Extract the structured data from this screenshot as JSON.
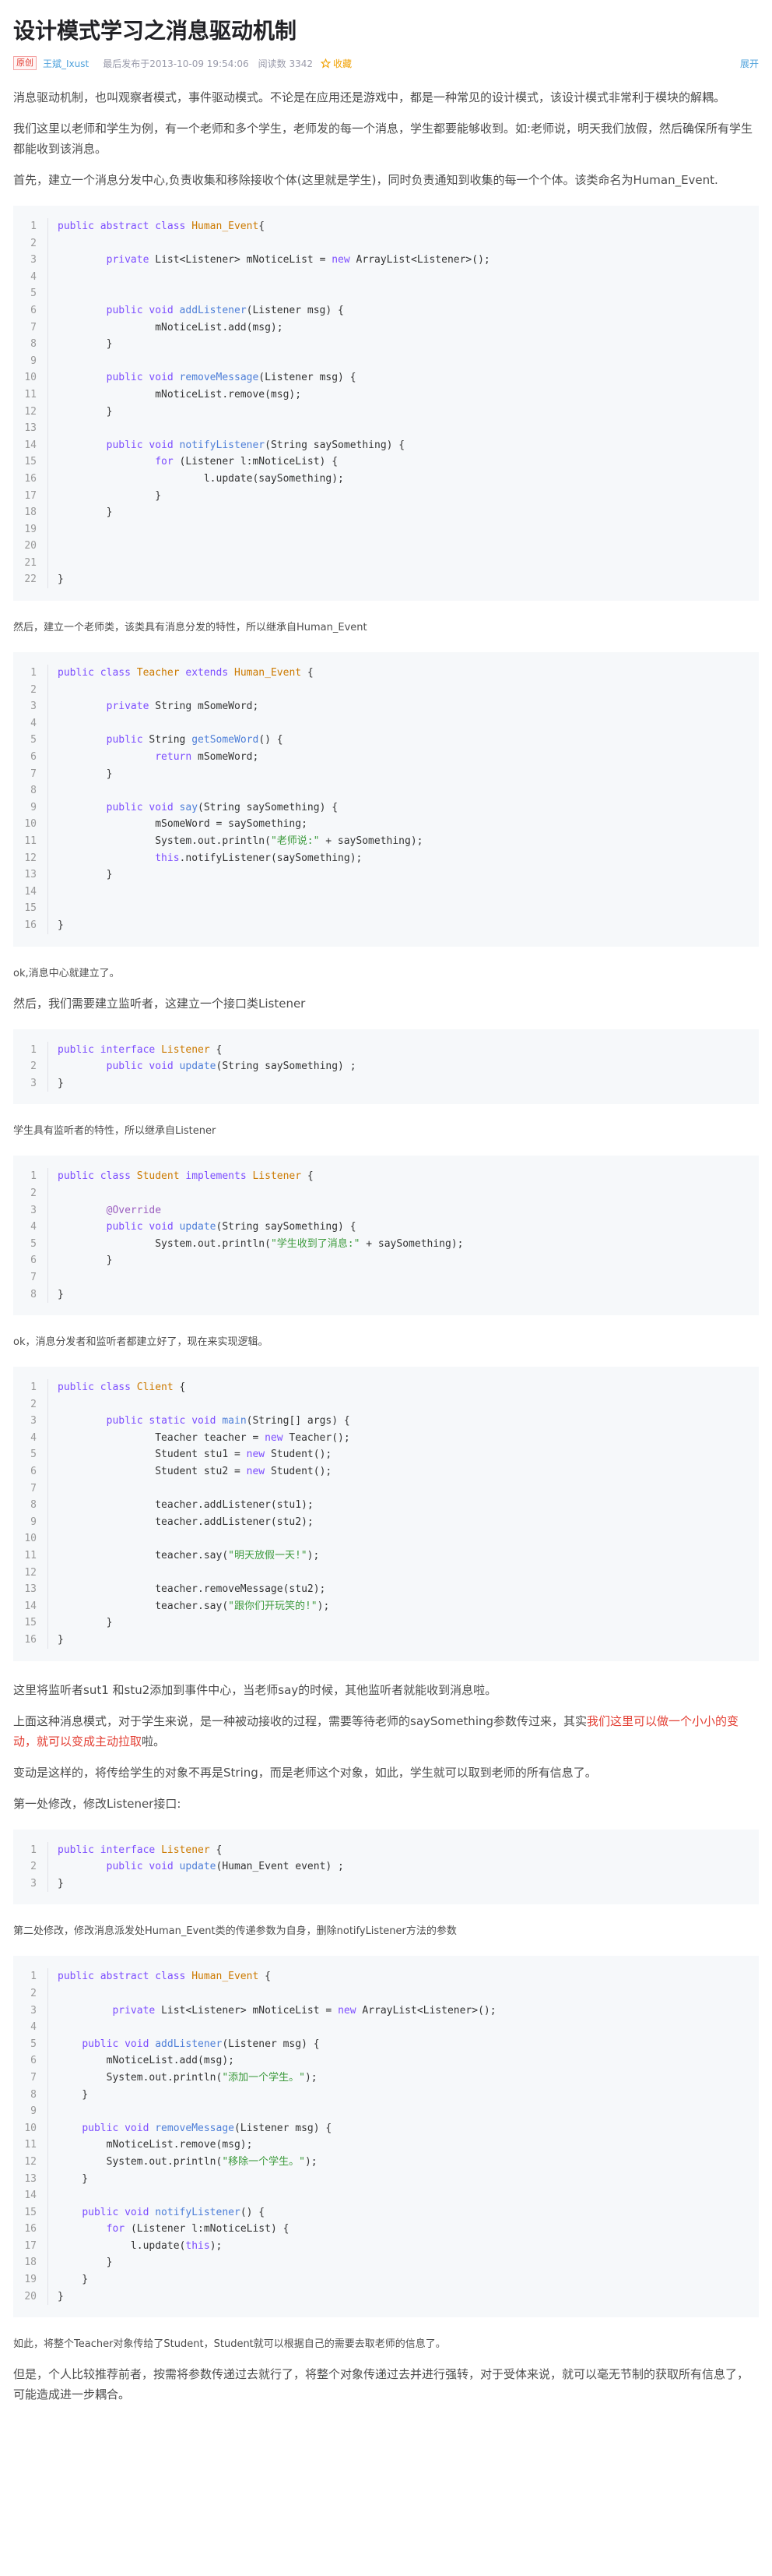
{
  "article": {
    "title": "设计模式学习之消息驱动机制",
    "meta": {
      "badge": "原创",
      "author": "王斌_Ixust",
      "date": "最后发布于2013-10-09 19:54:06",
      "views": "阅读数 3342",
      "favorite": "收藏",
      "expand": "展开"
    }
  },
  "paragraphs": {
    "p1": "消息驱动机制，也叫观察者模式，事件驱动模式。不论是在应用还是游戏中，都是一种常见的设计模式，该设计模式非常利于模块的解耦。",
    "p2": "我们这里以老师和学生为例，有一个老师和多个学生，老师发的每一个消息，学生都要能够收到。如:老师说，明天我们放假，然后确保所有学生都能收到该消息。",
    "p3": "首先，建立一个消息分发中心,负责收集和移除接收个体(这里就是学生)，同时负责通知到收集的每一个个体。该类命名为Human_Event.",
    "p4": "然后，建立一个老师类，该类具有消息分发的特性，所以继承自Human_Event",
    "p5": "ok,消息中心就建立了。",
    "p6": "然后，我们需要建立监听者，这建立一个接口类Listener",
    "p7": "学生具有监听者的特性，所以继承自Listener",
    "p8": "ok，消息分发者和监听者都建立好了，现在来实现逻辑。",
    "p9": "这里将监听者sut1 和stu2添加到事件中心，当老师say的时候，其他监听者就能收到消息啦。",
    "p10a": "上面这种消息模式，对于学生来说，是一种被动接收的过程，需要等待老师的saySomething参数传过来，其实",
    "p10b": "我们这里可以做一个小小的变动，就可以变成主动拉取",
    "p10c": "啦。",
    "p11": "变动是这样的，将传给学生的对象不再是String，而是老师这个对象，如此，学生就可以取到老师的所有信息了。",
    "p12": "第一处修改，修改Listener接口:",
    "p13": "第二处修改，修改消息派发处Human_Event类的传递参数为自身，删除notifyListener方法的参数",
    "p14": "如此，将整个Teacher对象传给了Student，Student就可以根据自己的需要去取老师的信息了。",
    "p15": "但是，个人比较推荐前者，按需将参数传递过去就行了，将整个对象传递过去并进行强转，对于受体来说，就可以毫无节制的获取所有信息了，可能造成进一步耦合。"
  },
  "code": {
    "block1": [
      [
        [
          "kw",
          "public abstract class "
        ],
        [
          "ty",
          "Human_Event"
        ],
        [
          "",
          "{"
        ]
      ],
      [],
      [
        [
          "",
          "        "
        ],
        [
          "kw",
          "private "
        ],
        [
          "",
          "List<Listener> mNoticeList = "
        ],
        [
          "kw",
          "new "
        ],
        [
          "",
          "ArrayList<Listener>();"
        ]
      ],
      [],
      [],
      [
        [
          "",
          "        "
        ],
        [
          "kw",
          "public void "
        ],
        [
          "fn",
          "addListener"
        ],
        [
          "",
          "(Listener msg) {"
        ]
      ],
      [
        [
          "",
          "                mNoticeList.add(msg);"
        ]
      ],
      [
        [
          "",
          "        }"
        ]
      ],
      [],
      [
        [
          "",
          "        "
        ],
        [
          "kw",
          "public void "
        ],
        [
          "fn",
          "removeMessage"
        ],
        [
          "",
          "(Listener msg) {"
        ]
      ],
      [
        [
          "",
          "                mNoticeList.remove(msg);"
        ]
      ],
      [
        [
          "",
          "        }"
        ]
      ],
      [],
      [
        [
          "",
          "        "
        ],
        [
          "kw",
          "public void "
        ],
        [
          "fn",
          "notifyListener"
        ],
        [
          "",
          "(String saySomething) {"
        ]
      ],
      [
        [
          "",
          "                "
        ],
        [
          "kw",
          "for "
        ],
        [
          "",
          "(Listener l:mNoticeList) {"
        ]
      ],
      [
        [
          "",
          "                        l.update(saySomething);"
        ]
      ],
      [
        [
          "",
          "                }"
        ]
      ],
      [
        [
          "",
          "        }"
        ]
      ],
      [],
      [],
      [],
      [
        [
          "",
          "}"
        ]
      ]
    ],
    "block2": [
      [
        [
          "kw",
          "public class "
        ],
        [
          "ty",
          "Teacher "
        ],
        [
          "kw",
          "extends "
        ],
        [
          "ty",
          "Human_Event "
        ],
        [
          "",
          "{"
        ]
      ],
      [],
      [
        [
          "",
          "        "
        ],
        [
          "kw",
          "private "
        ],
        [
          "",
          "String mSomeWord;"
        ]
      ],
      [],
      [
        [
          "",
          "        "
        ],
        [
          "kw",
          "public "
        ],
        [
          "",
          "String "
        ],
        [
          "fn",
          "getSomeWord"
        ],
        [
          "",
          "() {"
        ]
      ],
      [
        [
          "",
          "                "
        ],
        [
          "kw",
          "return "
        ],
        [
          "",
          "mSomeWord;"
        ]
      ],
      [
        [
          "",
          "        }"
        ]
      ],
      [],
      [
        [
          "",
          "        "
        ],
        [
          "kw",
          "public void "
        ],
        [
          "fn",
          "say"
        ],
        [
          "",
          "(String saySomething) {"
        ]
      ],
      [
        [
          "",
          "                mSomeWord = saySomething;"
        ]
      ],
      [
        [
          "",
          "                System.out.println("
        ],
        [
          "str",
          "\"老师说:\" "
        ],
        [
          "",
          "+ saySomething);"
        ]
      ],
      [
        [
          "",
          "                "
        ],
        [
          "kw",
          "this"
        ],
        [
          "",
          ".notifyListener(saySomething);"
        ]
      ],
      [
        [
          "",
          "        }"
        ]
      ],
      [],
      [],
      [
        [
          "",
          "}"
        ]
      ]
    ],
    "block3": [
      [
        [
          "kw",
          "public interface "
        ],
        [
          "ty",
          "Listener "
        ],
        [
          "",
          "{"
        ]
      ],
      [
        [
          "",
          "        "
        ],
        [
          "kw",
          "public void "
        ],
        [
          "fn",
          "update"
        ],
        [
          "",
          "(String saySomething) ;"
        ]
      ],
      [
        [
          "",
          "}"
        ]
      ]
    ],
    "block4": [
      [
        [
          "kw",
          "public class "
        ],
        [
          "ty",
          "Student "
        ],
        [
          "kw",
          "implements "
        ],
        [
          "ty",
          "Listener "
        ],
        [
          "",
          "{"
        ]
      ],
      [],
      [
        [
          "",
          "        "
        ],
        [
          "an",
          "@Override"
        ]
      ],
      [
        [
          "",
          "        "
        ],
        [
          "kw",
          "public void "
        ],
        [
          "fn",
          "update"
        ],
        [
          "",
          "(String saySomething) {"
        ]
      ],
      [
        [
          "",
          "                System.out.println("
        ],
        [
          "str",
          "\"学生收到了消息:\" "
        ],
        [
          "",
          "+ saySomething);"
        ]
      ],
      [
        [
          "",
          "        }"
        ]
      ],
      [],
      [
        [
          "",
          "}"
        ]
      ]
    ],
    "block5": [
      [
        [
          "kw",
          "public class "
        ],
        [
          "ty",
          "Client "
        ],
        [
          "",
          "{"
        ]
      ],
      [],
      [
        [
          "",
          "        "
        ],
        [
          "kw",
          "public static void "
        ],
        [
          "fn",
          "main"
        ],
        [
          "",
          "(String[] args) {"
        ]
      ],
      [
        [
          "",
          "                Teacher teacher = "
        ],
        [
          "kw",
          "new "
        ],
        [
          "",
          "Teacher();"
        ]
      ],
      [
        [
          "",
          "                Student stu1 = "
        ],
        [
          "kw",
          "new "
        ],
        [
          "",
          "Student();"
        ]
      ],
      [
        [
          "",
          "                Student stu2 = "
        ],
        [
          "kw",
          "new "
        ],
        [
          "",
          "Student();"
        ]
      ],
      [],
      [
        [
          "",
          "                teacher.addListener(stu1);"
        ]
      ],
      [
        [
          "",
          "                teacher.addListener(stu2);"
        ]
      ],
      [],
      [
        [
          "",
          "                teacher.say("
        ],
        [
          "str",
          "\"明天放假一天!\""
        ],
        [
          "",
          ");"
        ]
      ],
      [],
      [
        [
          "",
          "                teacher.removeMessage(stu2);"
        ]
      ],
      [
        [
          "",
          "                teacher.say("
        ],
        [
          "str",
          "\"跟你们开玩笑的!\""
        ],
        [
          "",
          ");"
        ]
      ],
      [
        [
          "",
          "        }"
        ]
      ],
      [
        [
          "",
          "}"
        ]
      ]
    ],
    "block6": [
      [
        [
          "kw",
          "public interface "
        ],
        [
          "ty",
          "Listener "
        ],
        [
          "",
          "{"
        ]
      ],
      [
        [
          "",
          "        "
        ],
        [
          "kw",
          "public void "
        ],
        [
          "fn",
          "update"
        ],
        [
          "",
          "(Human_Event event) ;"
        ]
      ],
      [
        [
          "",
          "}"
        ]
      ]
    ],
    "block7": [
      [
        [
          "kw",
          "public abstract class "
        ],
        [
          "ty",
          "Human_Event "
        ],
        [
          "",
          "{"
        ]
      ],
      [],
      [
        [
          "",
          "         "
        ],
        [
          "kw",
          "private "
        ],
        [
          "",
          "List<Listener> mNoticeList = "
        ],
        [
          "kw",
          "new "
        ],
        [
          "",
          "ArrayList<Listener>();"
        ]
      ],
      [],
      [
        [
          "",
          "    "
        ],
        [
          "kw",
          "public void "
        ],
        [
          "fn",
          "addListener"
        ],
        [
          "",
          "(Listener msg) {"
        ]
      ],
      [
        [
          "",
          "        mNoticeList.add(msg);"
        ]
      ],
      [
        [
          "",
          "        System.out.println("
        ],
        [
          "str",
          "\"添加一个学生。\""
        ],
        [
          "",
          ");"
        ]
      ],
      [
        [
          "",
          "    }"
        ]
      ],
      [],
      [
        [
          "",
          "    "
        ],
        [
          "kw",
          "public void "
        ],
        [
          "fn",
          "removeMessage"
        ],
        [
          "",
          "(Listener msg) {"
        ]
      ],
      [
        [
          "",
          "        mNoticeList.remove(msg);"
        ]
      ],
      [
        [
          "",
          "        System.out.println("
        ],
        [
          "str",
          "\"移除一个学生。\""
        ],
        [
          "",
          ");"
        ]
      ],
      [
        [
          "",
          "    }"
        ]
      ],
      [],
      [
        [
          "",
          "    "
        ],
        [
          "kw",
          "public void "
        ],
        [
          "fn",
          "notifyListener"
        ],
        [
          "",
          "() {"
        ]
      ],
      [
        [
          "",
          "        "
        ],
        [
          "kw",
          "for "
        ],
        [
          "",
          "(Listener l:mNoticeList) {"
        ]
      ],
      [
        [
          "",
          "            l.update("
        ],
        [
          "kw",
          "this"
        ],
        [
          "",
          ");"
        ]
      ],
      [
        [
          "",
          "        }"
        ]
      ],
      [
        [
          "",
          "    }"
        ]
      ],
      [
        [
          "",
          "}"
        ]
      ]
    ]
  }
}
